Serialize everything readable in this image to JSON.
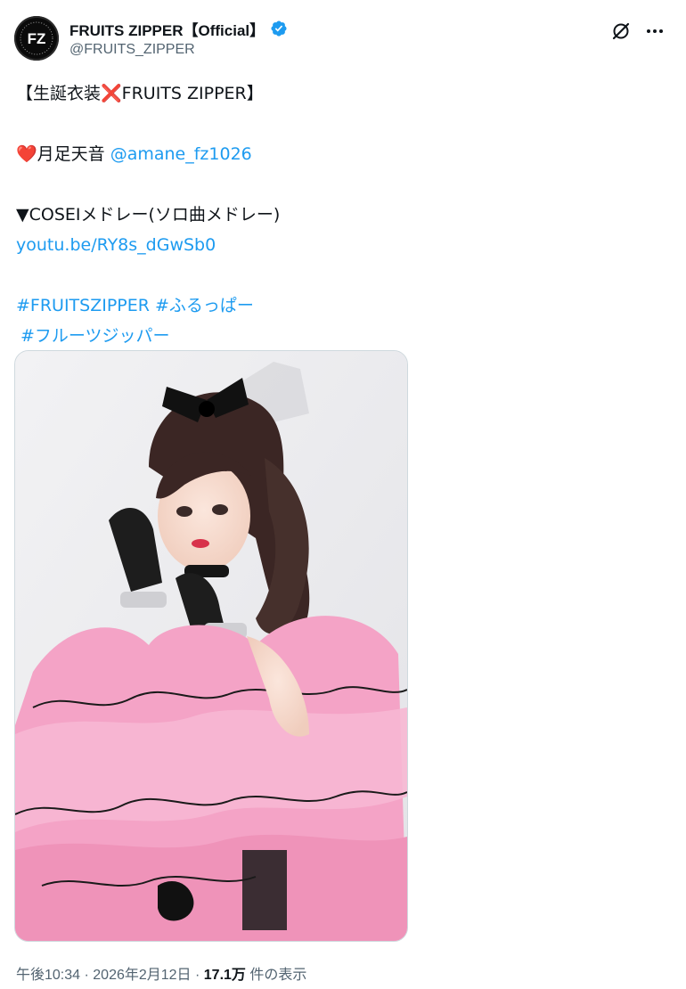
{
  "tweet": {
    "author": {
      "display_name": "FRUITS ZIPPER【Official】",
      "handle": "@FRUITS_ZIPPER",
      "avatar_text": "FZ",
      "verified": true
    },
    "text": {
      "line1": "【生誕衣装❌FRUITS ZIPPER】",
      "line2_emoji": "❤️",
      "line2_text": "月足天音 ",
      "line2_mention": "@amane_fz1026",
      "line3": "▼COSEIメドレー(ソロ曲メドレー)",
      "line4_link": "youtu.be/RY8s_dGwSb0",
      "line5_hashtag1": "#FRUITSZIPPER",
      "line5_hashtag2": "#ふるっぱー",
      "line6_hashtag": "#フルーツジッパー"
    },
    "media": {
      "description_icon": "photo-of-idol-in-pink-ruffled-dress"
    },
    "meta": {
      "time": "午後10:34",
      "separator1": " · ",
      "date": "2026年2月12日",
      "separator2": " · ",
      "views_count": "17.1万",
      "views_label": " 件の表示"
    }
  },
  "colors": {
    "link": "#1d9bf0",
    "verified": "#1d9bf0",
    "secondary_text": "#536471",
    "primary_text": "#0f1419",
    "dress_pink": "#f4a3c6"
  },
  "icons": {
    "grok": "grok-icon",
    "more": "more-icon",
    "verified": "verified-badge-icon"
  }
}
